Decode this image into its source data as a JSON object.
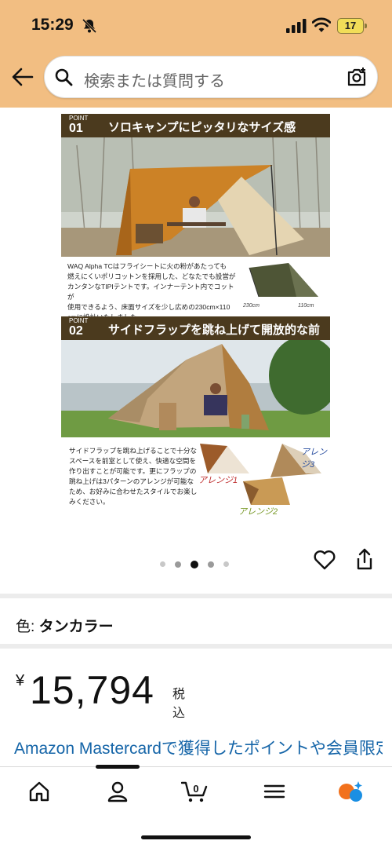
{
  "status_bar": {
    "time": "15:29",
    "battery": "17",
    "icons": [
      "bell-slash-icon",
      "cellular-signal-icon",
      "wifi-icon",
      "battery-icon"
    ]
  },
  "header": {
    "back_icon": "arrow-left-icon",
    "search_placeholder": "検索または質問する",
    "search_icon": "search-icon",
    "camera_icon": "camera-search-icon",
    "bg_color": "#f2be82"
  },
  "product_image": {
    "point1": {
      "label": "POINT",
      "number": "01",
      "title": "ソロキャンプにピッタリなサイズ感",
      "desc_lines": [
        "WAQ Alpha TCはフライシートに火の粉があたっても",
        "燃えにくいポリコットンを採用した、どなたでも設営が",
        "カンタンなTIPIテントです。インナーテント内でコットが",
        "使用できるよう、床面サイズを少し広めの230cm×110",
        "cmに設計いたしました。"
      ],
      "dim_a": "230cm",
      "dim_b": "110cm"
    },
    "point2": {
      "label": "POINT",
      "number": "02",
      "title": "サイドフラップを跳ね上げて開放的な前室を",
      "desc_lines": [
        "サイドフラップを跳ね上げることで十分な",
        "スペースを前室として使え、快適な空間を",
        "作り出すことが可能です。更にフラップの",
        "跳ね上げは3パターンのアレンジが可能な",
        "ため、お好みに合わせたスタイルでお楽し",
        "みください。"
      ],
      "arrange1": "アレンジ1",
      "arrange2": "アレンジ2",
      "arrange3": "アレンジ3"
    },
    "carousel_total": 5,
    "carousel_active": 3
  },
  "actions": {
    "like_icon": "heart-icon",
    "share_icon": "share-icon"
  },
  "color": {
    "label": "色: ",
    "value": "タンカラー"
  },
  "price": {
    "currency": "¥",
    "amount": "15,794",
    "tax": "税込"
  },
  "promo": {
    "text": "Amazon Mastercardで獲得したポイントや会員限定特典を今すぐ確認！"
  },
  "bottom_nav": {
    "items": [
      "home-icon",
      "account-icon",
      "cart-icon",
      "menu-icon",
      "rufus-ai-icon"
    ],
    "cart_count": "0"
  }
}
